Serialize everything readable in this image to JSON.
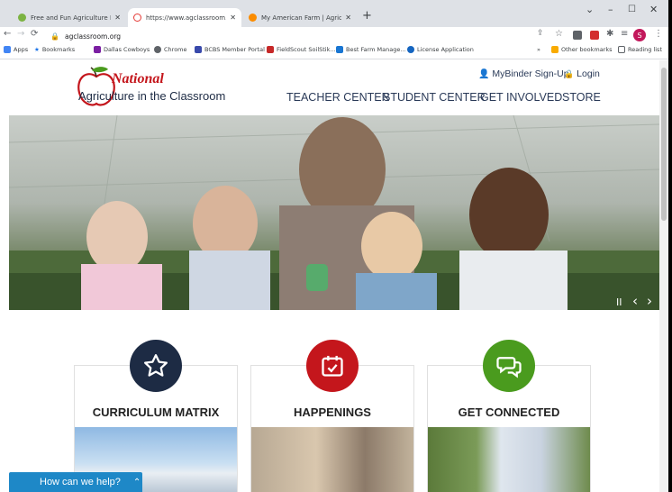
{
  "browser": {
    "tabs": [
      {
        "title": "Free and Fun Agriculture Educati",
        "favicon_color": "#7cb342"
      },
      {
        "title": "https://www.agclassroom.org",
        "favicon_color": "#e53935"
      },
      {
        "title": "My American Farm | Agricultural",
        "favicon_color": "#fb8c00"
      }
    ],
    "new_tab": "+",
    "url": "agclassroom.org",
    "bookmarks": [
      {
        "label": "Apps",
        "color": "#4285f4"
      },
      {
        "label": "Bookmarks",
        "color": "#1a73e8"
      },
      {
        "label": "Dallas Cowboys",
        "color": "#7b1fa2"
      },
      {
        "label": "Chrome",
        "color": "#5f6368"
      },
      {
        "label": "BCBS Member Portal",
        "color": "#3949ab"
      },
      {
        "label": "FieldScout SoilStik...",
        "color": "#c62828"
      },
      {
        "label": "Best Farm Manage...",
        "color": "#1976d2"
      },
      {
        "label": "License Application",
        "color": "#1565c0"
      }
    ],
    "overflow": "»",
    "other_bookmarks": "Other bookmarks",
    "reading_list": "Reading list",
    "profile_initial": "S"
  },
  "site": {
    "logo": {
      "script": "National",
      "line": "Agriculture in the Classroom"
    },
    "utility": {
      "signup": "MyBinder Sign-Up",
      "login": "Login"
    },
    "nav": [
      "TEACHER CENTER",
      "STUDENT CENTER",
      "GET INVOLVED",
      "STORE"
    ],
    "slider_controls": {
      "pause": "II",
      "prev": "‹",
      "next": "›"
    },
    "cards": [
      {
        "title": "CURRICULUM MATRIX",
        "icon": "star-icon",
        "color": "#1d2b44"
      },
      {
        "title": "HAPPENINGS",
        "icon": "calendar-check-icon",
        "color": "#c4161c"
      },
      {
        "title": "GET CONNECTED",
        "icon": "chat-bubbles-icon",
        "color": "#4a9b1e"
      }
    ],
    "help": "How can we help?"
  }
}
